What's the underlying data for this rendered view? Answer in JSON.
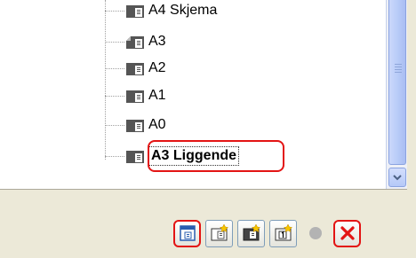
{
  "tree": {
    "items": [
      {
        "label": "A4 Skjema",
        "icon": "page-layout-icon"
      },
      {
        "label": "A3",
        "icon": "page-layout-folded-icon"
      },
      {
        "label": "A2",
        "icon": "page-layout-icon"
      },
      {
        "label": "A1",
        "icon": "page-layout-icon"
      },
      {
        "label": "A0",
        "icon": "page-layout-icon"
      },
      {
        "label": "A3 Liggende",
        "icon": "page-layout-icon",
        "selected": true
      }
    ]
  },
  "toolbar": {
    "buttons": [
      {
        "name": "page-setup-button",
        "icon": "page-settings-icon"
      },
      {
        "name": "new-layout-button",
        "icon": "new-page-icon"
      },
      {
        "name": "new-layout-from-template-button",
        "icon": "new-dark-page-icon"
      },
      {
        "name": "new-numbered-layout-button",
        "icon": "new-numbered-page-icon"
      },
      {
        "name": "record-button",
        "icon": "gray-circle-icon"
      },
      {
        "name": "delete-button",
        "icon": "red-x-icon"
      }
    ]
  },
  "colors": {
    "highlight": "#e31414",
    "selection_border": "#333333"
  }
}
